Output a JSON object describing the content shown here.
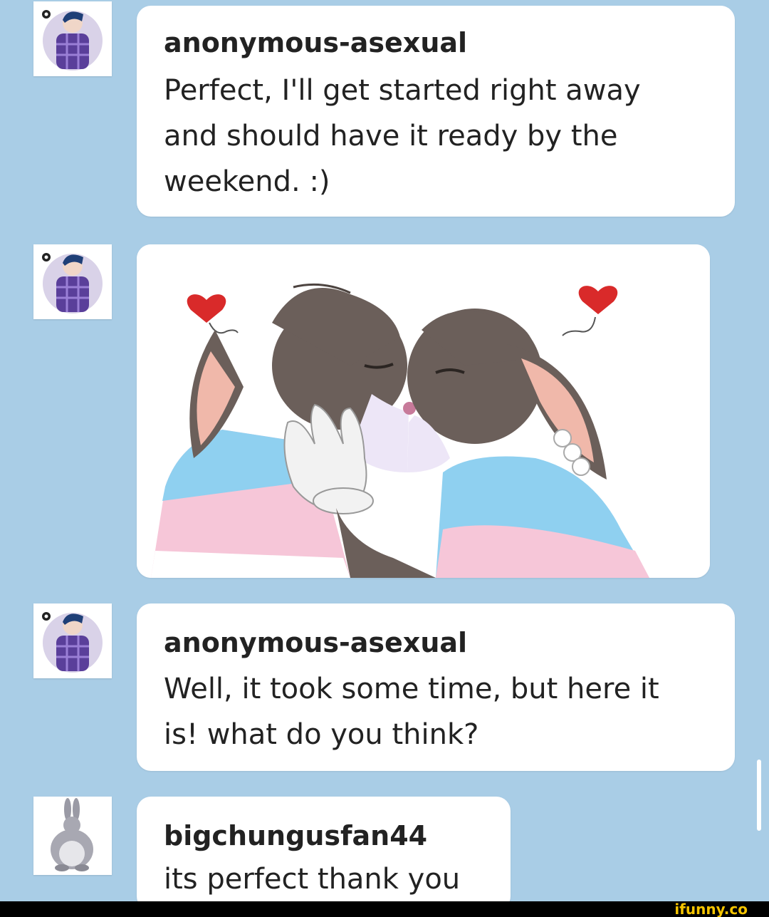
{
  "messages": [
    {
      "username": "anonymous-asexual",
      "text": "Perfect, I'll get started right away\nand should have it ready by the\nweekend. :)",
      "avatar": "person-plaid-shirt-avatar"
    },
    {
      "type": "image",
      "avatar": "person-plaid-shirt-avatar",
      "image": "two-bunnies-kissing-illustration"
    },
    {
      "username": "anonymous-asexual",
      "text": "Well, it took some time, but here it\nis! what do you think?",
      "avatar": "person-plaid-shirt-avatar"
    },
    {
      "username": "bigchungusfan44",
      "text": "its perfect thank you",
      "avatar": "chunky-rabbit-avatar"
    }
  ],
  "watermark": "ifunny.co",
  "colors": {
    "background": "#a9cde6",
    "bubble": "#ffffff",
    "text": "#222222",
    "watermark": "#f5c400"
  }
}
